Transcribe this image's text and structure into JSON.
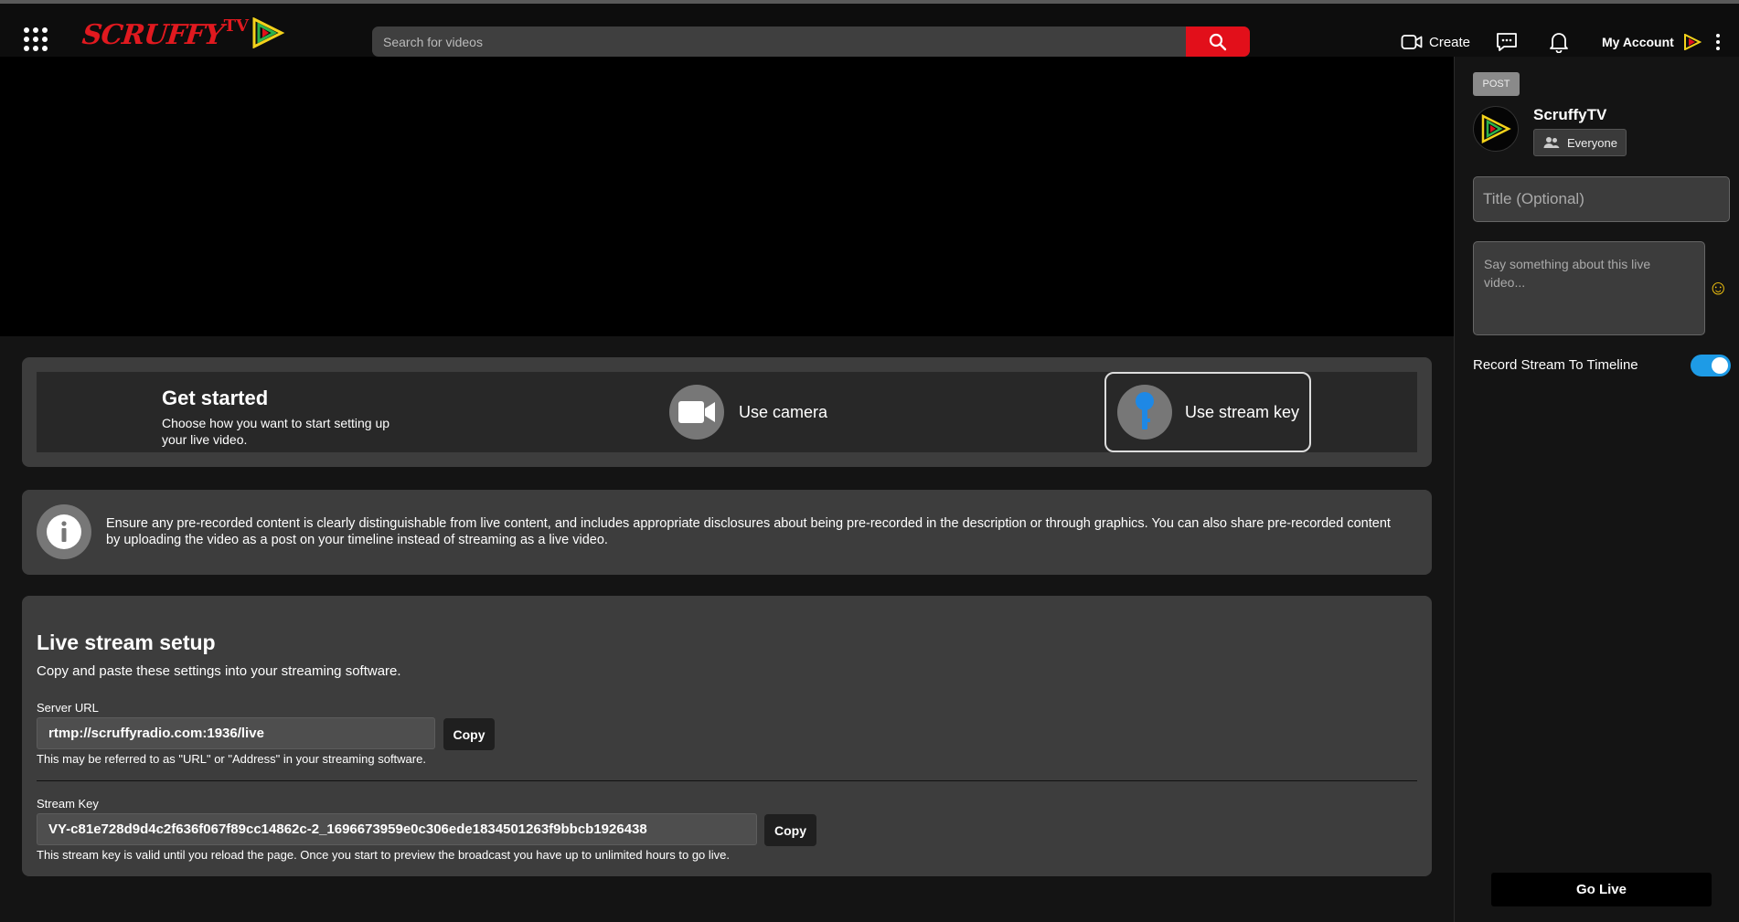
{
  "header": {
    "logo_text": "SCRUFFY",
    "logo_sup": "TV",
    "search_placeholder": "Search for videos",
    "create_label": "Create",
    "account_label": "My Account"
  },
  "get_started": {
    "title": "Get started",
    "subtitle": "Choose how you want to start setting up your live video.",
    "camera_label": "Use camera",
    "stream_key_label": "Use stream key"
  },
  "notice": {
    "text": "Ensure any pre-recorded content is clearly distinguishable from live content, and includes appropriate disclosures about being pre-recorded in the description or through graphics. You can also share pre-recorded content by uploading the video as a post on your timeline instead of streaming as a live video."
  },
  "live_setup": {
    "title": "Live stream setup",
    "subtitle": "Copy and paste these settings into your streaming software.",
    "server_url_label": "Server URL",
    "server_url_value": "rtmp://scruffyradio.com:1936/live",
    "server_url_hint": "This may be referred to as \"URL\" or \"Address\" in your streaming software.",
    "stream_key_label": "Stream Key",
    "stream_key_value": "VY-c81e728d9d4c2f636f067f89cc14862c-2_1696673959e0c306ede1834501263f9bbcb1926438",
    "stream_key_hint": "This stream key is valid until you reload the page. Once you start to preview the broadcast you have up to unlimited hours to go live.",
    "copy_label": "Copy"
  },
  "sidebar": {
    "post_tag": "POST",
    "channel_name": "ScruffyTV",
    "audience_label": "Everyone",
    "title_placeholder": "Title (Optional)",
    "description_placeholder": "Say something about this live video...",
    "record_label": "Record Stream To Timeline",
    "record_enabled": true,
    "go_live_label": "Go Live"
  },
  "colors": {
    "brand_red": "#e20f1a",
    "toggle_blue": "#1e9be6",
    "key_blue": "#1e88e5"
  }
}
